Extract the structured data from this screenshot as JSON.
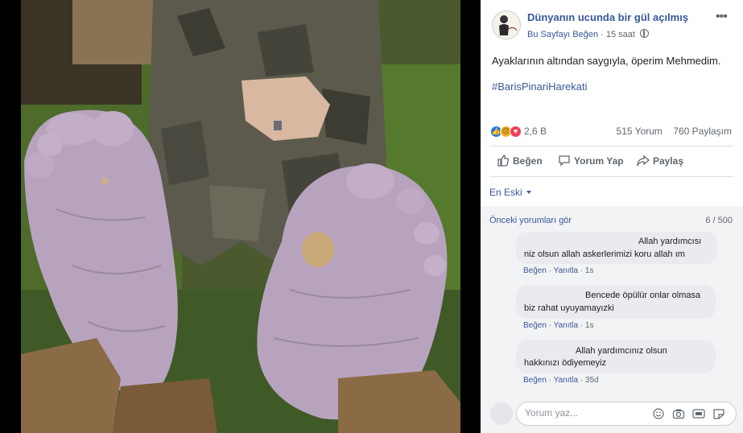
{
  "post": {
    "page_name": "Dünyanın ucunda bir gül açılmış",
    "follow_label": "Bu Sayfayı Beğen",
    "separator": "·",
    "time": "15 saat",
    "text": "Ayaklarının altından saygıyla, öperim Mehmedim.",
    "hashtag": "#BarisPinariHarekati",
    "options_icon": "ellipsis-icon",
    "privacy_icon": "globe-icon"
  },
  "reactions": {
    "types": [
      "like",
      "sad",
      "love"
    ],
    "count": "2,6 B",
    "comments": "515 Yorum",
    "shares": "760 Paylaşım"
  },
  "actions": {
    "like": "Beğen",
    "comment": "Yorum Yap",
    "share": "Paylaş"
  },
  "sort": {
    "label": "En Eski"
  },
  "comments": {
    "previous_label": "Önceki yorumları gör",
    "page_count": "6 / 500",
    "like_label": "Beğen",
    "reply_label": "Yanıtla",
    "items": [
      {
        "line1": "Allah yardımcısı",
        "line2": "niz olsun allah askerlerimizi koru allah ım",
        "time": "1s"
      },
      {
        "line1": "Bencede öpülür onlar olmasa",
        "line2": "biz rahat uyuyamayızki",
        "time": "1s"
      },
      {
        "line1": "Allah yardımcınız olsun",
        "line2": "hakkınızı ödiyemeyiz",
        "time": "35d"
      }
    ]
  },
  "composer": {
    "placeholder": "Yorum yaz...",
    "icons": [
      "emoji-icon",
      "camera-icon",
      "gif-icon",
      "sticker-icon"
    ]
  },
  "colors": {
    "link": "#385898",
    "meta": "#606770",
    "bubble": "#e9ebee",
    "comments_bg": "#f2f3f5"
  }
}
